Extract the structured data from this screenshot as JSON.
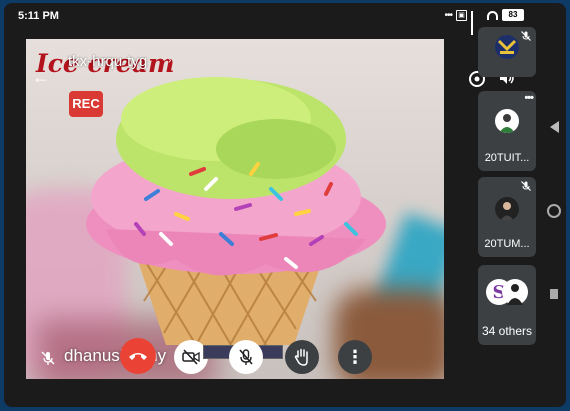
{
  "status_bar": {
    "time": "5:11 PM",
    "battery": "83"
  },
  "meeting": {
    "code": "tkx-hrqu-tyg",
    "recording_badge": "REC",
    "background_title": "Ice cream",
    "presenter_name": "dhanush rithy"
  },
  "participants": [
    {
      "label": ""
    },
    {
      "label": "20TUIT..."
    },
    {
      "label": "20TUM..."
    },
    {
      "label": "34 others"
    }
  ],
  "colors": {
    "end_call": "#ea4335",
    "rec": "#d93a33",
    "tile_bg": "#3c4043"
  }
}
